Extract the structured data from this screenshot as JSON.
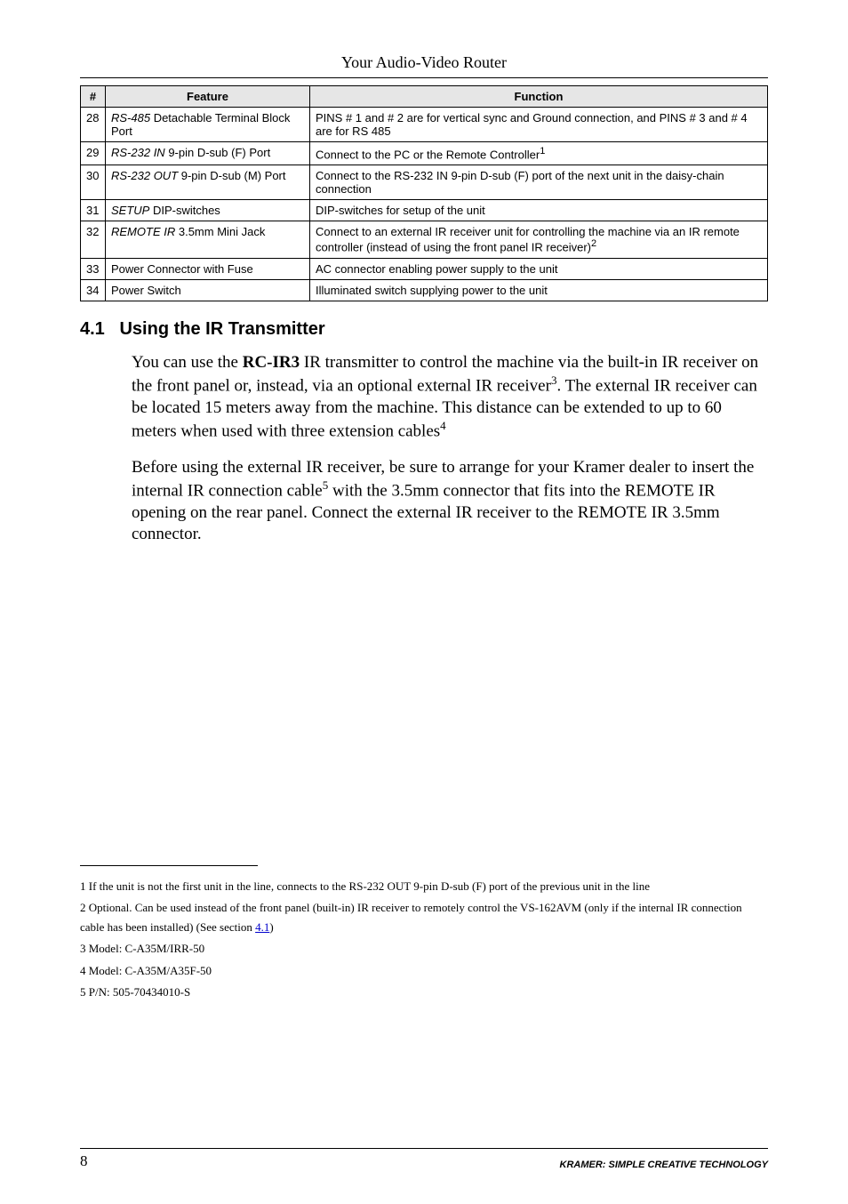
{
  "header": {
    "title": "Your Audio-Video Router"
  },
  "table": {
    "headers": {
      "num": "#",
      "feature": "Feature",
      "function": "Function"
    },
    "rows": [
      {
        "num": "28",
        "feature_italic": "RS-485",
        "feature_rest": " Detachable Terminal Block Port",
        "function": "PINS # 1 and # 2 are for vertical sync and Ground connection, and PINS # 3 and # 4 are for RS 485"
      },
      {
        "num": "29",
        "feature_italic": "RS-232 IN",
        "feature_rest": " 9-pin D-sub (F) Port",
        "function": "Connect to the PC or the Remote Controller",
        "fn_sup": "1"
      },
      {
        "num": "30",
        "feature_italic": "RS-232 OUT",
        "feature_rest": " 9-pin D-sub (M) Port",
        "function": "Connect to the RS-232 IN 9-pin D-sub (F) port of the next unit in the daisy-chain connection"
      },
      {
        "num": "31",
        "feature_italic": "SETUP",
        "feature_rest": " DIP-switches",
        "function": "DIP-switches for setup of the unit"
      },
      {
        "num": "32",
        "feature_italic": "REMOTE IR",
        "feature_rest": " 3.5mm Mini Jack",
        "function": "Connect to an external IR receiver unit for controlling the machine via an IR remote controller (instead of using the front panel IR receiver)",
        "fn_sup": "2"
      },
      {
        "num": "33",
        "feature_plain": "Power Connector with Fuse",
        "function": "AC connector enabling power supply to the unit"
      },
      {
        "num": "34",
        "feature_plain": "Power Switch",
        "function": "Illuminated switch supplying power to the unit"
      }
    ]
  },
  "section": {
    "num": "4.1",
    "title": "Using the IR Transmitter"
  },
  "para1": {
    "a": "You can use the ",
    "bold": "RC-IR3",
    "b": " IR transmitter to control the machine via the built-in IR receiver on the front panel or, instead, via an optional external IR receiver",
    "sup1": "3",
    "c": ". The external IR receiver can be located 15 meters away from the machine. This distance can be extended to up to 60 meters when used with three extension cables",
    "sup2": "4"
  },
  "para2": {
    "a": "Before using the external IR receiver, be sure to arrange for your Kramer dealer to insert the internal IR connection cable",
    "sup": "5",
    "b": " with the 3.5mm connector that fits into the REMOTE IR opening on the rear panel. Connect the external IR receiver to the REMOTE IR 3.5mm connector."
  },
  "footnotes": {
    "f1": "1 If the unit is not the first unit in the line, connects to the RS-232 OUT 9-pin D-sub (F) port of the previous unit in the line",
    "f2a": "2 Optional. Can be used instead of the front panel (built-in) IR receiver to remotely control the VS-162AVM (only if the internal IR connection cable has been installed) (See section ",
    "f2link": "4.1",
    "f2b": ")",
    "f3": "3 Model: C-A35M/IRR-50",
    "f4": "4 Model: C-A35M/A35F-50",
    "f5": "5 P/N: 505-70434010-S"
  },
  "footer": {
    "page": "8",
    "brand": "KRAMER:  SIMPLE CREATIVE TECHNOLOGY"
  }
}
